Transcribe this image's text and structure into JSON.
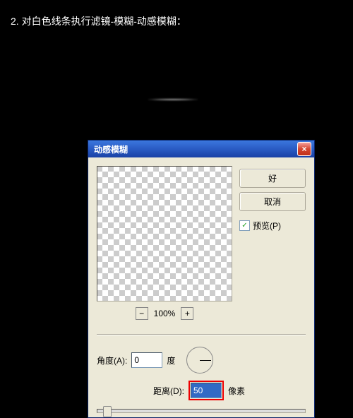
{
  "instruction": "2. 对白色线条执行滤镜-模糊-动感模糊：",
  "dialog": {
    "title": "动感模糊",
    "close": "×",
    "ok": "好",
    "cancel": "取消",
    "preview_label": "预览(P)",
    "preview_checked": "✓",
    "zoom_minus": "−",
    "zoom_plus": "+",
    "zoom_pct": "100%",
    "angle_label": "角度(A):",
    "angle_value": "0",
    "angle_unit": "度",
    "distance_label": "距离(D):",
    "distance_value": "50",
    "distance_unit": "像素"
  }
}
